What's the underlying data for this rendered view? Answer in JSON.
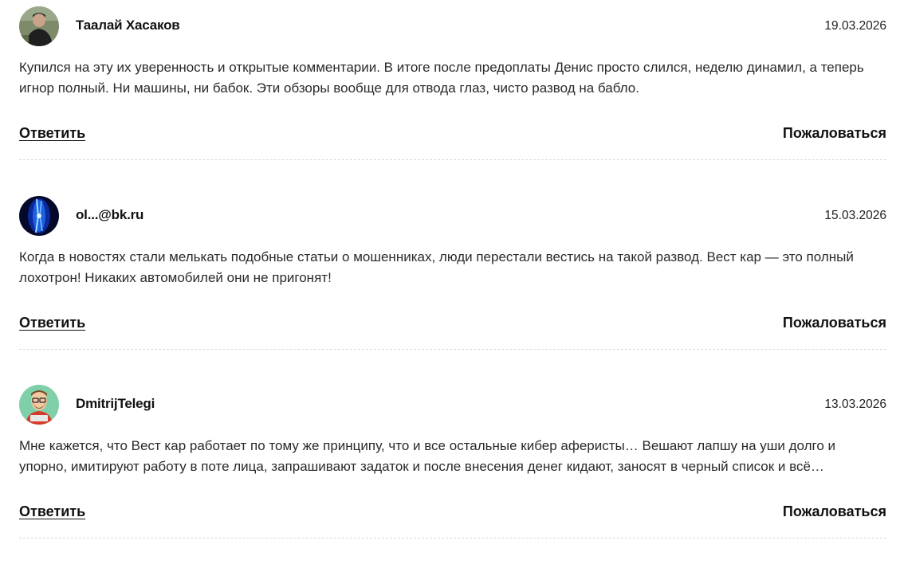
{
  "comments": [
    {
      "author": "Таалай Хасаков",
      "date": "19.03.2026",
      "text": "Купился на эту их уверенность и открытые комментарии. В итоге после предоплаты Денис просто слился, неделю динамил, а теперь игнор полный. Ни машины, ни бабок. Эти обзоры вообще для отвода глаз, чисто развод на бабло.",
      "reply_label": "Ответить",
      "report_label": "Пожаловаться"
    },
    {
      "author": "ol...@bk.ru",
      "date": "15.03.2026",
      "text": "Когда в новостях стали мелькать подобные статьи о мошенниках, люди перестали вестись на такой развод. Вест кар — это полный лохотрон! Никаких автомобилей они не пригонят!",
      "reply_label": "Ответить",
      "report_label": "Пожаловаться"
    },
    {
      "author": "DmitrijTelegi",
      "date": "13.03.2026",
      "text": "Мне кажется, что Вест кар работает по тому же принципу, что и все остальные кибер аферисты… Вешают лапшу на уши долго и упорно, имитируют работу в поте лица, запрашивают задаток и после внесения денег кидают, заносят в черный список и всё…",
      "reply_label": "Ответить",
      "report_label": "Пожаловаться"
    }
  ]
}
